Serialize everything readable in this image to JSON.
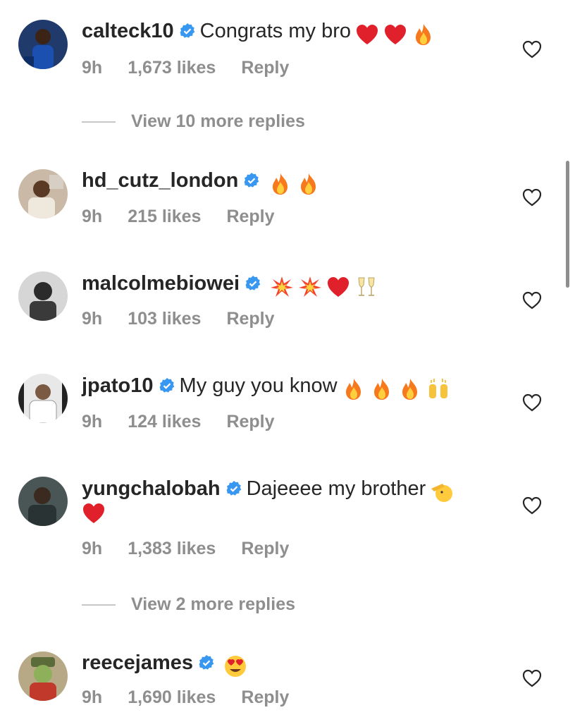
{
  "comments": [
    {
      "username": "calteck10",
      "text": "Congrats my bro",
      "emojis": [
        "red-heart",
        "red-heart",
        "fire"
      ],
      "time": "9h",
      "likes": "1,673 likes",
      "reply": "Reply"
    },
    {
      "username": "hd_cutz_london",
      "text": "",
      "emojis": [
        "fire",
        "fire"
      ],
      "time": "9h",
      "likes": "215 likes",
      "reply": "Reply"
    },
    {
      "username": "malcolmebiowei",
      "text": "",
      "emojis": [
        "collision",
        "collision",
        "red-heart",
        "clinking-glasses"
      ],
      "time": "9h",
      "likes": "103 likes",
      "reply": "Reply"
    },
    {
      "username": "jpato10",
      "text": "My guy you know",
      "emojis": [
        "fire",
        "fire",
        "fire",
        "raising-hands"
      ],
      "time": "9h",
      "likes": "124 likes",
      "reply": "Reply"
    },
    {
      "username": "yungchalobah",
      "text": "Dajeeee my brother",
      "emojis": [
        "saluting-face",
        "red-heart"
      ],
      "time": "9h",
      "likes": "1,383 likes",
      "reply": "Reply"
    },
    {
      "username": "reecejames",
      "text": "",
      "emojis": [
        "heart-eyes-face"
      ],
      "time": "9h",
      "likes": "1,690 likes",
      "reply": "Reply"
    }
  ],
  "view_more_replies": [
    "View 10 more replies",
    "View 2 more replies"
  ],
  "colors": {
    "text": "#262626",
    "secondary": "#8e8e8e",
    "verified": "#3897f0"
  }
}
